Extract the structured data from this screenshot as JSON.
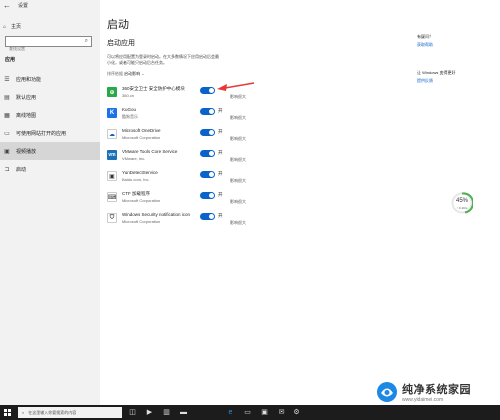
{
  "window": {
    "title": "设置"
  },
  "sidebar": {
    "home": "主页",
    "search_placeholder": "查找设置",
    "section": "应用",
    "items": [
      {
        "label": "应用和功能",
        "icon": "list-icon"
      },
      {
        "label": "默认应用",
        "icon": "default-apps-icon"
      },
      {
        "label": "离线地图",
        "icon": "map-icon"
      },
      {
        "label": "可使用网站打开的应用",
        "icon": "web-apps-icon"
      },
      {
        "label": "视频播放",
        "icon": "video-icon"
      },
      {
        "label": "启动",
        "icon": "startup-icon",
        "active": true
      }
    ]
  },
  "main": {
    "title": "启动",
    "subheading": "启动应用",
    "description": "可以将应用配置为登录时启动。在大多数情况下应用启动后会最小化，或者可能只启动后台任务。",
    "sort_label": "排序依据",
    "sort_value": "启动影响",
    "apps": [
      {
        "name": "360安全卫士 安全防护中心模块",
        "publisher": "360.cn",
        "toggle": "开",
        "impact": "影响很大",
        "icon_color": "#2aa84a",
        "icon_text": "⊕"
      },
      {
        "name": "KuGou",
        "publisher": "酷狗音乐",
        "toggle": "开",
        "impact": "影响很大",
        "icon_color": "#1a73e8",
        "icon_text": "K"
      },
      {
        "name": "Microsoft OneDrive",
        "publisher": "Microsoft Corporation",
        "toggle": "开",
        "impact": "影响很大",
        "icon_color": "#ffffff",
        "icon_text": "☁"
      },
      {
        "name": "VMware Tools Core Service",
        "publisher": "VMware, Inc.",
        "toggle": "开",
        "impact": "影响很大",
        "icon_color": "#1d6fb8",
        "icon_text": "vm"
      },
      {
        "name": "YunDetectService",
        "publisher": "Baidu.com, Inc.",
        "toggle": "开",
        "impact": "影响很大",
        "icon_color": "#ffffff",
        "icon_text": "▣"
      },
      {
        "name": "CTF 加载程序",
        "publisher": "Microsoft Corporation",
        "toggle": "开",
        "impact": "影响很大",
        "icon_color": "#ffffff",
        "icon_text": "⌨"
      },
      {
        "name": "Windows Security notification icon",
        "publisher": "Microsoft Corporation",
        "toggle": "开",
        "impact": "影响很大",
        "icon_color": "#ffffff",
        "icon_text": "⛉"
      }
    ]
  },
  "right_panel": {
    "question": "有疑问？",
    "help_link": "获取帮助",
    "improve": "让 Windows 变得更好",
    "feedback_link": "提供反馈"
  },
  "gauge": {
    "value": "45%",
    "sub": "↑ 0.1K/s"
  },
  "watermark": {
    "title": "纯净系统家园",
    "url": "www.yidaimei.com"
  },
  "taskbar": {
    "search_placeholder": "在这里输入你要搜索的内容"
  },
  "colors": {
    "accent": "#0a63c9",
    "sidebar_bg": "#f2f2f2",
    "active_nav": "#d6d6d6"
  }
}
